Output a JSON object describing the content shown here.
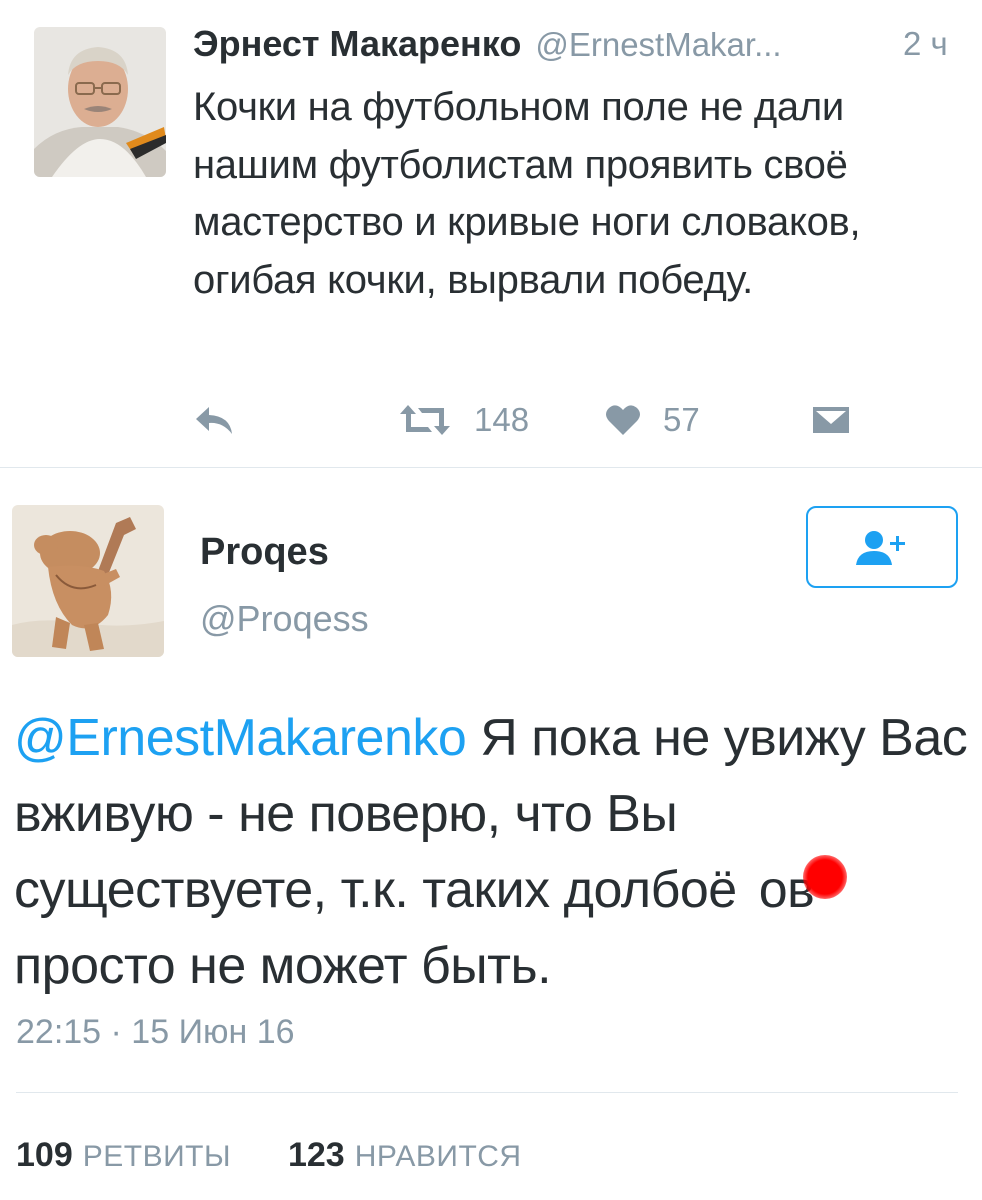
{
  "reply_to_tweet": {
    "name": "Эрнест Макаренко",
    "handle": "@ErnestMakar...",
    "time": "2 ч",
    "text": "Кочки на футбольном поле не дали нашим футболистам проявить своё мастерство и кривые ноги словаков, огибая кочки, вырвали победу.",
    "actions": {
      "reply_icon": "reply-icon",
      "retweet_icon": "retweet-icon",
      "retweet_count": "148",
      "like_icon": "heart-icon",
      "like_count": "57",
      "dm_icon": "envelope-icon"
    }
  },
  "main_tweet": {
    "name": "Proqes",
    "handle": "@Proqess",
    "follow_icon": "add-user-icon",
    "mention": "@ErnestMakarenko",
    "text_part1": " Я пока не увижу Вас вживую - не поверю, что Вы существуете, т.к. таких долбоё",
    "text_part2": "ов просто не может быть.",
    "timestamp": "22:15 · 15 Июн 16",
    "stats": {
      "retweets_count": "109",
      "retweets_label": "РЕТВИТЫ",
      "likes_count": "123",
      "likes_label": "НРАВИТСЯ"
    }
  },
  "colors": {
    "accent": "#1da1f2",
    "muted": "#8899a6",
    "text": "#292f33",
    "divider": "#e1e8ed",
    "censor": "#ff0000"
  }
}
